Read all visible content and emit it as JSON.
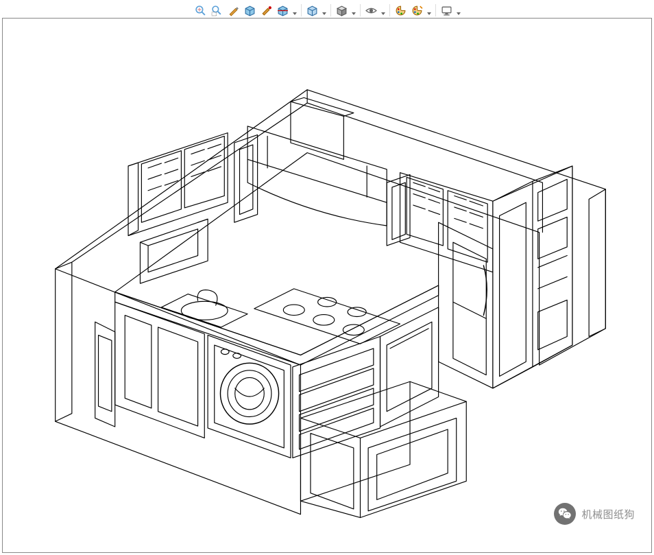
{
  "toolbar": {
    "icons": [
      "zoom-fit",
      "zoom-window",
      "brush",
      "box-display",
      "paint-tool",
      "section-box",
      "",
      "box-blue",
      "",
      "cube-shaded",
      "",
      "eye-show",
      "",
      "palette-1",
      "palette-2",
      "",
      "monitor"
    ]
  },
  "watermark": {
    "text": "机械图纸狗"
  },
  "model": {
    "description": "3D isometric wireframe kitchen layout with cabinets, appliances, island"
  }
}
